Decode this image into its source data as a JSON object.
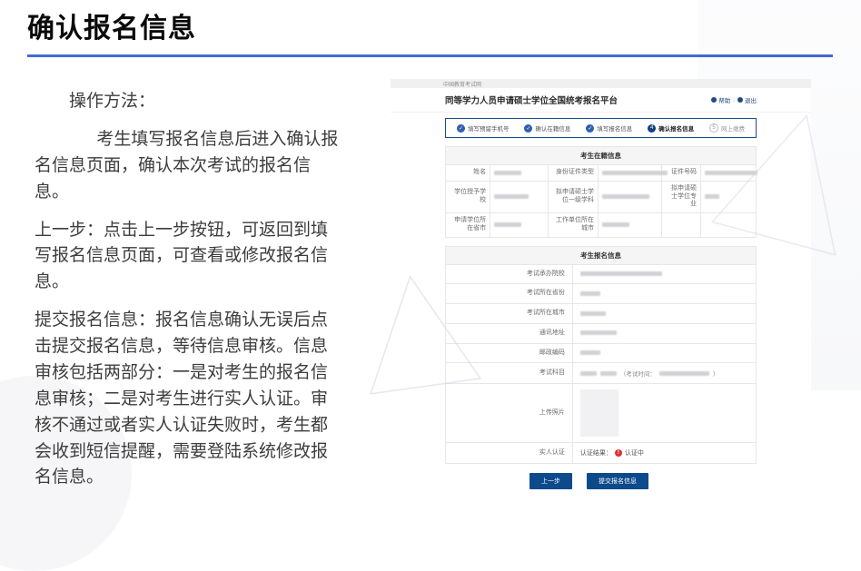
{
  "colors": {
    "accent_navy": "#0d4a8c",
    "divider_blue": "#4667d6",
    "step_blue": "#2f5fae",
    "step_active_navy": "#123f7e",
    "error_red": "#e03131"
  },
  "slide": {
    "title": "确认报名信息",
    "paragraphs": [
      "操作方法：",
      "考生填写报名信息后进入确认报名信息页面，确认本次考试的报名信息。",
      "上一步：点击上一步按钮，可返回到填写报名信息页面，可查看或修改报名信息。",
      "提交报名信息：报名信息确认无误后点击提交报名信息，等待信息审核。信息审核包括两部分：一是对考生的报名信息审核；二是对考生进行实人认证。审核不通过或者实人认证失败时，考生都会收到短信提醒，需要登陆系统修改报名信息。"
    ]
  },
  "shot": {
    "topbar": "中国教育考试网",
    "header": {
      "title": "同等学力人员申请硕士学位全国统考报名平台",
      "actions": [
        {
          "label": "帮助"
        },
        {
          "label": "退出"
        }
      ],
      "separator": "|"
    },
    "steps": [
      {
        "mark": "✓",
        "label": "填写预留手机号",
        "state": "done"
      },
      {
        "mark": "✓",
        "label": "确认在籍信息",
        "state": "done"
      },
      {
        "mark": "✓",
        "label": "填写报名信息",
        "state": "done"
      },
      {
        "mark": "4",
        "label": "确认报名信息",
        "state": "active"
      },
      {
        "mark": "5",
        "label": "网上缴费",
        "state": "todo"
      }
    ],
    "enroll": {
      "title": "考生在籍信息",
      "labels": [
        "姓名",
        "身份证件类型",
        "证件号码",
        "学位授予学校",
        "拟申请硕士学位一级学科",
        "拟申请硕士学位专业",
        "申请学位所在省市",
        "工作单位所在城市"
      ]
    },
    "reg": {
      "title": "考生报名信息",
      "labels": [
        "考试承办院校",
        "考试所在省份",
        "考试所在城市",
        "通讯地址",
        "邮政编码",
        "考试科目",
        "上传照片",
        "实人认证"
      ],
      "exam_time_prefix": "（考试时间：",
      "exam_time_suffix": "）",
      "auth_result_label": "认证结果：",
      "auth_status": "认证中"
    },
    "buttons": {
      "prev": "上一步",
      "submit": "提交报名信息"
    }
  }
}
